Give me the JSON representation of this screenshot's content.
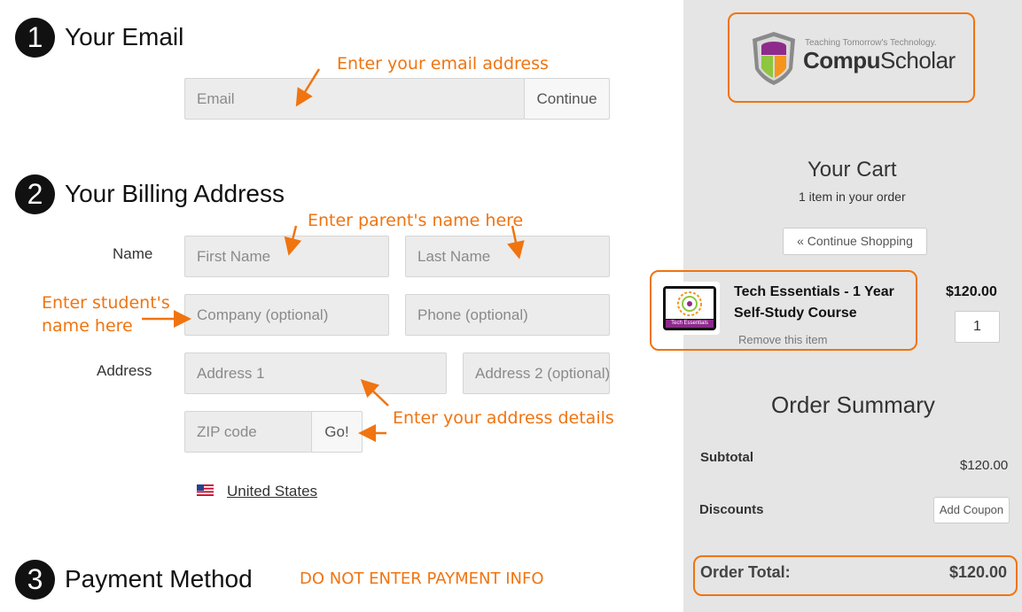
{
  "step1": {
    "number": "1",
    "title": "Your Email"
  },
  "email": {
    "placeholder": "Email",
    "continue_label": "Continue"
  },
  "step2": {
    "number": "2",
    "title": "Your Billing Address"
  },
  "billing": {
    "name_label": "Name",
    "first_name_placeholder": "First Name",
    "last_name_placeholder": "Last Name",
    "company_placeholder": "Company (optional)",
    "phone_placeholder": "Phone (optional)",
    "address_label": "Address",
    "address1_placeholder": "Address 1",
    "address2_placeholder": "Address 2 (optional)",
    "zip_placeholder": "ZIP code",
    "go_label": "Go!",
    "country": "United States"
  },
  "step3": {
    "number": "3",
    "title": "Payment Method"
  },
  "annotations": {
    "email": "Enter your email address",
    "parent_name": "Enter parent's name here",
    "student_line1": "Enter student's",
    "student_line2": "name here",
    "address": "Enter your address details",
    "payment": "DO NOT ENTER PAYMENT INFO"
  },
  "logo": {
    "tagline": "Teaching Tomorrow's Technology.",
    "brand_part1": "Compu",
    "brand_part2": "Scholar"
  },
  "cart": {
    "title": "Your Cart",
    "item_count": "1 item in your order",
    "continue_shopping": "Continue Shopping",
    "item": {
      "name_line1": "Tech Essentials - 1 Year",
      "name_line2": "Self-Study Course",
      "thumbnail_label": "Tech Essentials",
      "remove_label": "Remove this item",
      "price": "$120.00",
      "quantity": "1"
    }
  },
  "summary": {
    "title": "Order Summary",
    "subtotal_label": "Subtotal",
    "subtotal_value": "$120.00",
    "discounts_label": "Discounts",
    "add_coupon": "Add Coupon",
    "total_label": "Order Total:",
    "total_value": "$120.00"
  },
  "colors": {
    "annotation": "#f07410",
    "sidebar": "#e5e5e5",
    "field": "#ececec"
  },
  "icons": {
    "continue_shopping": "double-chevron-left-icon",
    "country_flag": "us-flag-icon"
  }
}
